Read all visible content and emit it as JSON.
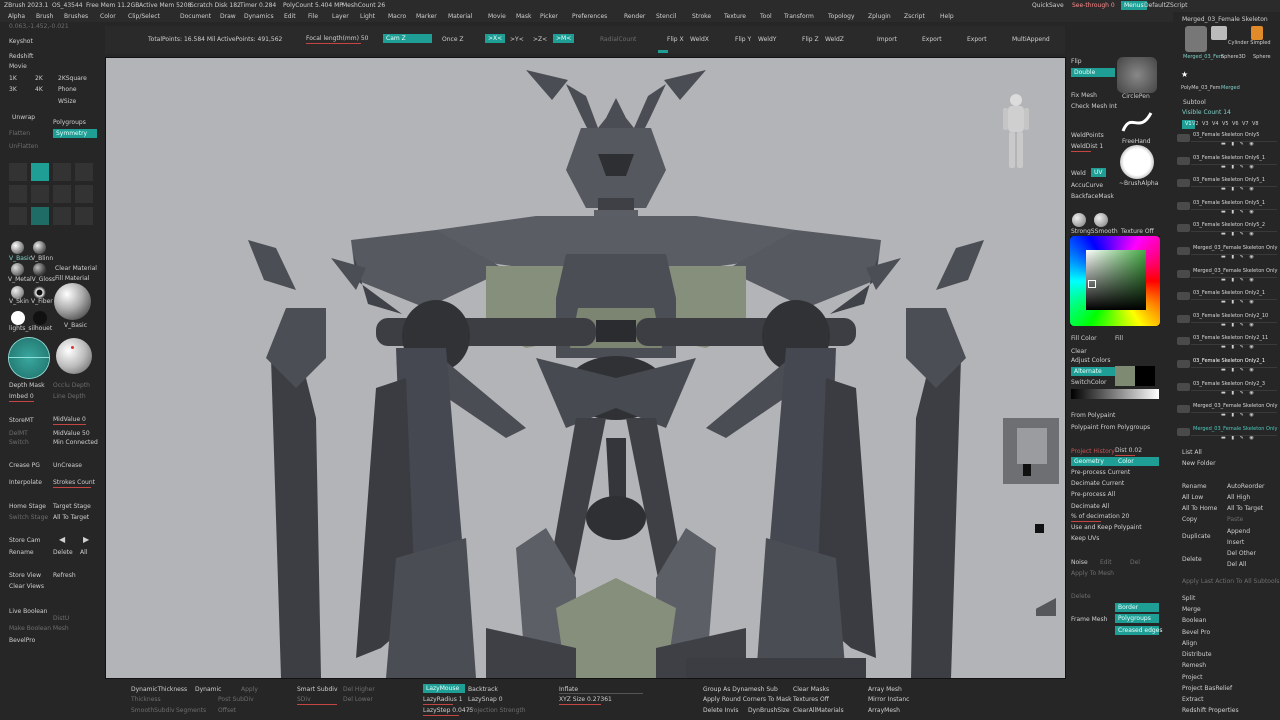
{
  "titlebar": {
    "app": "ZBrush 2023.1",
    "os": "OS_43544",
    "free_mem": "Free Mem 11.2GB",
    "active_mem": "Active Mem 5208",
    "scratch": "Scratch Disk 182",
    "timer": "Timer 0.284",
    "polycount": "PolyCount 5.404 MP",
    "meshcount": "MeshCount 26",
    "coords": "0.063,-1.452,-0.021",
    "quicksave": "QuickSave",
    "see_through": "See-through 0",
    "menus_btn": "Menus",
    "default_zscript": "DefaultZScript"
  },
  "menus": [
    "Alpha",
    "Brush",
    "Brushes",
    "Color",
    "Clip/Select",
    "Document",
    "Draw",
    "Dynamics",
    "Edit",
    "File",
    "Layer",
    "Light",
    "Macro",
    "Marker",
    "Material",
    "Movie",
    "Mask",
    "Picker",
    "Preferences",
    "Render",
    "Stencil",
    "Stroke",
    "Texture",
    "Tool",
    "Transform",
    "Topology",
    "Zplugin",
    "Zscript",
    "Help"
  ],
  "topbar": {
    "total_points": "TotalPoints: 16.584 Mil",
    "active_points": "ActivePoints: 491,562",
    "focal_length": "Focal length(mm) 50",
    "persp_btn": "Cam Z",
    "once_z": "Once Z",
    "x_btn": ">X<",
    "y_btn": ">Y<",
    "z_btn": ">Z<",
    "m_btn": ">M<",
    "radial_count": "RadialCount",
    "flip_x": "Flip X",
    "weld_x": "WeldX",
    "flip_y": "Flip Y",
    "weld_y": "WeldY",
    "flip_z": "Flip Z",
    "weld_z": "WeldZ",
    "import": "Import",
    "export": "Export",
    "export2": "Export",
    "multi_append": "MultiAppend"
  },
  "left": {
    "keyshot": "Keyshot",
    "redshift": "Redshift",
    "movie": "Movie",
    "r1k": "1K",
    "r2k": "2K",
    "r2ksquare": "2KSquare",
    "r3k": "3K",
    "r4k": "4K",
    "phone": "Phone",
    "wsize": "WSize",
    "unwrap": "Unwrap",
    "polygroups": "Polygroups",
    "flatten": "Flatten",
    "symmetry": "Symmetry",
    "unflatten": "UnFlatten",
    "v_basic": "V_Basic",
    "v_blinn": "V_Blinn",
    "v_metalv_gloss": "V_MetalV_Gloss",
    "clear_material": "Clear Material",
    "fill_material": "Fill Material",
    "v_skin": "V_Skin",
    "v_fiber": "V_Fiber",
    "v_basic2": "V_Basic",
    "lights_silhouet": "lights_silhouet",
    "depth_mask": "Depth Mask",
    "occlu_depth": "Occlu Depth",
    "imbed": "Imbed 0",
    "line_depth": "Line Depth",
    "store_mt": "StoreMT",
    "mid_value": "MidValue 0",
    "del_mt": "DelMT",
    "mid_value50": "MidValue 50",
    "switch": "Switch",
    "min_connected": "Min Connected",
    "crease_pg": "Crease PG",
    "uncrease": "UnCrease",
    "interpolate": "Interpolate",
    "strokes_count": "Strokes Count",
    "home_stage": "Home Stage",
    "target_stage": "Target Stage",
    "switch_stage": "Switch Stage",
    "all_to_target": "All To Target",
    "store_cam": "Store Cam",
    "rename": "Rename",
    "delete": "Delete",
    "all": "All",
    "store_view": "Store View",
    "refresh": "Refresh",
    "clear_views": "Clear Views",
    "live_boolean": "Live Boolean",
    "dist": "DistU",
    "make_boolean_mesh": "Make Boolean Mesh",
    "bevel_pro": "BevelPro"
  },
  "right": {
    "flip": "Flip",
    "double": "Double",
    "circle_pen": "CirclePen",
    "fix_mesh": "Fix Mesh",
    "check_mesh_int": "Check Mesh Int",
    "freehand": "FreeHand",
    "weld_points": "WeldPoints",
    "weld_dist": "WeldDist 1",
    "weld": "Weld",
    "uv": "UV",
    "accu_curve": "AccuCurve",
    "brush_alpha": "~BrushAlpha",
    "backface_mask": "BackfaceMask",
    "strong_smooth": "StrongSSmooth",
    "texture_off": "Texture Off",
    "fill_color": "Fill Color",
    "fill": "Fill",
    "clear": "Clear",
    "adjust_colors": "Adjust Colors",
    "alternate": "Alternate",
    "switch_color": "SwitchColor",
    "from_polypaint": "From Polypaint",
    "polypaint_from_polygroups": "Polypaint From Polygroups",
    "project_history": "Project History",
    "dist": "Dist 0.02",
    "geometry": "Geometry",
    "color": "Color",
    "preprocess_current": "Pre-process Current",
    "decimate_current": "Decimate Current",
    "preprocess_all": "Pre-process All",
    "decimate_all": "Decimate All",
    "pct_decimation": "% of decimation 20",
    "use_keep_polypaint": "Use and Keep Polypaint",
    "keep_uvs": "Keep UVs",
    "noise": "Noise",
    "edit": "Edit",
    "del": "Del",
    "apply_to_mesh": "Apply To Mesh",
    "delete": "Delete",
    "frame_mesh": "Frame Mesh",
    "border": "Border",
    "polygroups": "Polygroups",
    "creased_edges": "Creased edges"
  },
  "colors": {
    "accent": "#1f9e96",
    "panel": "#262626",
    "viewport": "#b3b4b8",
    "mech_dark": "#4b4e55",
    "mech_green": "#868f7b"
  },
  "subtool": {
    "tool_name": "Merged_03_Female Skeleton",
    "thumbs": [
      "Cylinder Simpled",
      "Merged_03_Fem",
      "Sphere3D",
      "Sphere",
      "PolyMe_03_Fem",
      "Merged"
    ],
    "title": "Subtool",
    "visible_count": "Visible Count 14",
    "versions": [
      "V1",
      "V2",
      "V3",
      "V4",
      "V5",
      "V6",
      "V7",
      "V8"
    ],
    "items": [
      "03_Female Skeleton Only5",
      "03_Female Skeleton Only6_1",
      "03_Female Skeleton Only5_1",
      "03_Female Skeleton Only5_1",
      "03_Female Skeleton Only5_2",
      "Merged_03_Female Skeleton Only",
      "Merged_03_Female Skeleton Only",
      "03_Female Skeleton Only2_1",
      "03_Female Skeleton Only2_10",
      "03_Female Skeleton Only2_11",
      "03_Female Skeleton Only2_1",
      "03_Female Skeleton Only2_3",
      "Merged_03_Female Skeleton Only",
      "Merged_03_Female Skeleton Only"
    ],
    "list_all": "List All",
    "new_folder": "New Folder",
    "rename": "Rename",
    "auto_reorder": "AutoReorder",
    "all_low": "All Low",
    "all_high": "All High",
    "all_to_home": "All To Home",
    "all_to_target": "All To Target",
    "copy": "Copy",
    "paste": "Paste",
    "duplicate": "Duplicate",
    "append": "Append",
    "insert": "Insert",
    "delete": "Delete",
    "del_other": "Del Other",
    "del_all": "Del All",
    "apply_last": "Apply Last Action To All Subtools",
    "split": "Split",
    "merge": "Merge",
    "boolean": "Boolean",
    "bevel_pro": "Bevel Pro",
    "align": "Align",
    "distribute": "Distribute",
    "remesh": "Remesh",
    "project": "Project",
    "project_basrelief": "Project BasRelief",
    "extract": "Extract",
    "redshift_properties": "Redshift Properties"
  },
  "bottom": {
    "dynamic_thickness": "DynamicThickness",
    "dynamic": "Dynamic",
    "apply": "Apply",
    "thickness": "Thickness",
    "post_subdiv": "Post SubDiv",
    "smooth_subdiv": "SmoothSubdiv",
    "segments": "Segments",
    "offset": "Offset",
    "smart_subdiv": "Smart Subdiv",
    "del_higher": "Del Higher",
    "sdiv": "SDiv",
    "del_lower": "Del Lower",
    "lazy_mouse": "LazyMouse",
    "backtrack": "Backtrack",
    "lazy_radius": "LazyRadius 1",
    "lazy_snap": "LazySnap 0",
    "lazy_step": "LazyStep 0.0475",
    "projection_strength": "Projection Strength",
    "inflate": "Inflate",
    "xyz_size": "XYZ Size 0.27361",
    "group_dynamesh": "Group As Dynamesh Sub",
    "apply_round": "Apply Round Corners To Mask",
    "delete_invis": "Delete Invis",
    "dyn_brush_size": "DynBrushSize",
    "clear_masks": "Clear Masks",
    "textures_off": "Textures Off",
    "clear_all_materials": "ClearAllMaterials",
    "array_mesh": "Array Mesh",
    "mirror_instance": "Mirror Instanc",
    "array_mesh2": "ArrayMesh"
  }
}
